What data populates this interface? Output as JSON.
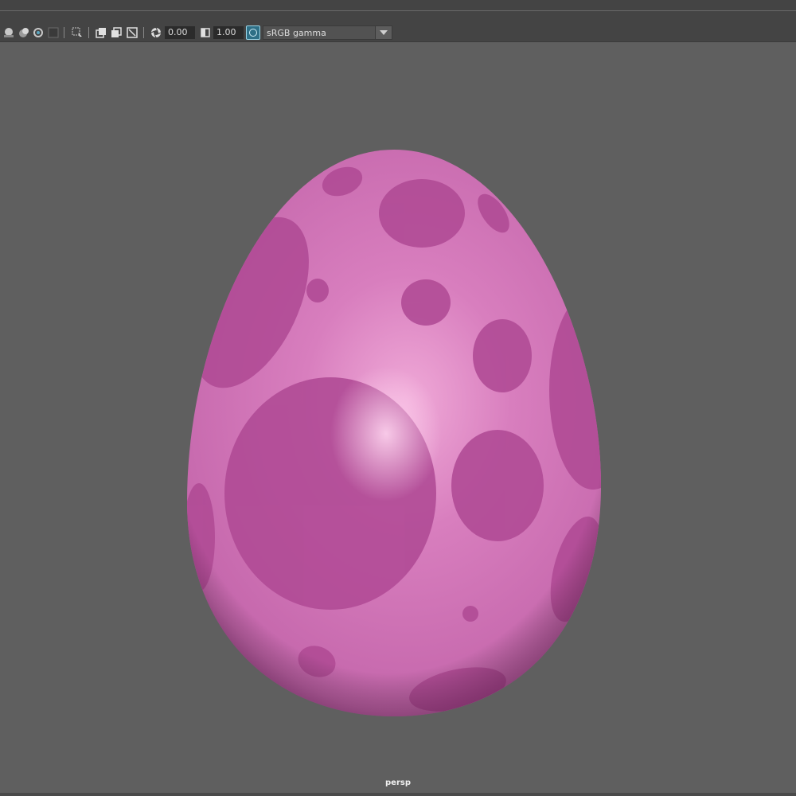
{
  "toolbar": {
    "exposure_value": "0.00",
    "gamma_value": "1.00",
    "color_space": "sRGB gamma"
  },
  "viewport": {
    "camera_label": "persp",
    "object": "egg",
    "colors": {
      "background": "#5f5f5f",
      "egg_base": "#d57bbb",
      "egg_spots": "#b04a95",
      "highlight": "#f6c6e6"
    }
  }
}
